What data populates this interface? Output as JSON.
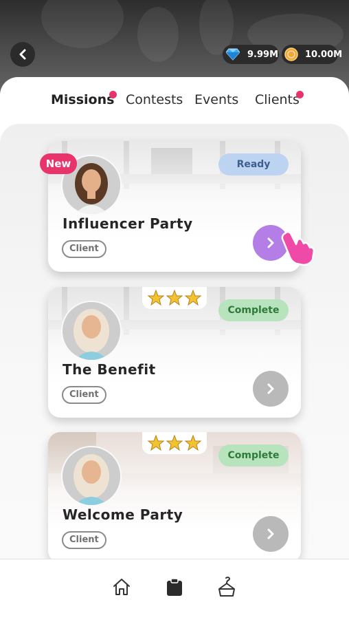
{
  "currency": {
    "gems": "9.99M",
    "coins": "10.00M"
  },
  "tabs": [
    {
      "label": "Missions",
      "active": true,
      "has_dot": true
    },
    {
      "label": "Contests",
      "active": false,
      "has_dot": false
    },
    {
      "label": "Events",
      "active": false,
      "has_dot": false
    },
    {
      "label": "Clients",
      "active": false,
      "has_dot": true
    }
  ],
  "missions": [
    {
      "title": "Influencer Party",
      "tag": "Client",
      "status": "Ready",
      "badge": "New",
      "stars": 0
    },
    {
      "title": "The Benefit",
      "tag": "Client",
      "status": "Complete",
      "badge": "",
      "stars": 3
    },
    {
      "title": "Welcome Party",
      "tag": "Client",
      "status": "Complete",
      "badge": "",
      "stars": 3
    }
  ],
  "colors": {
    "accent_pink": "#e8336b",
    "ready_bg": "#bcd3f2",
    "complete_bg": "#b7e3bd",
    "go_active": "#b57de6"
  },
  "icons": {
    "back": "chevron-left-icon",
    "gems": "diamond-icon",
    "coins": "coin-icon",
    "nav": [
      "home-icon",
      "clipboard-icon",
      "hanger-icon"
    ]
  }
}
